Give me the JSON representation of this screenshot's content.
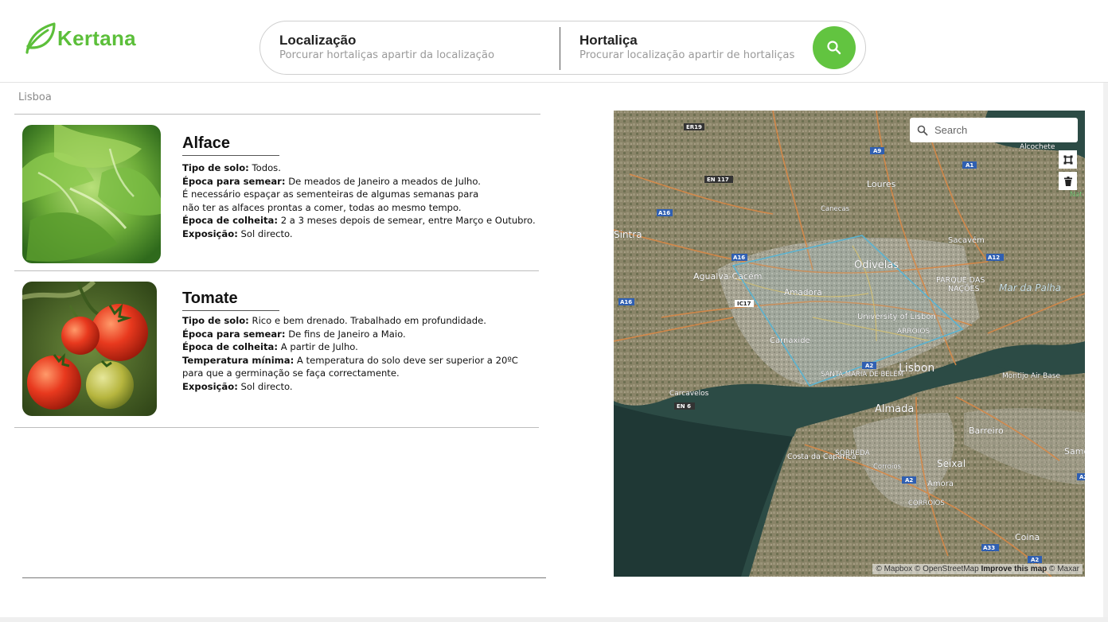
{
  "brand": {
    "name": "Kertana"
  },
  "search": {
    "location": {
      "title": "Localização",
      "placeholder": "Porcurar hortaliças apartir da localização"
    },
    "vegetable": {
      "title": "Hortaliça",
      "placeholder": "Procurar localização apartir de hortaliças"
    },
    "button_icon": "search-icon"
  },
  "breadcrumb": "Lisboa",
  "results": [
    {
      "name": "Alface",
      "lines": [
        {
          "label": "Tipo de solo:",
          "text": " Todos."
        },
        {
          "label": "Época para semear:",
          "text": " De meados de Janeiro a meados de Julho."
        },
        {
          "label": "",
          "text": "É necessário espaçar as sementeiras de algumas semanas para"
        },
        {
          "label": "",
          "text": "não ter as alfaces prontas a comer, todas ao mesmo tempo."
        },
        {
          "label": "Época de colheita:",
          "text": " 2 a 3 meses depois de semear, entre Março e Outubro."
        },
        {
          "label": "Exposição:",
          "text": " Sol directo."
        }
      ]
    },
    {
      "name": "Tomate",
      "lines": [
        {
          "label": "Tipo de solo:",
          "text": " Rico e bem drenado. Trabalhado em profundidade."
        },
        {
          "label": "Época para semear:",
          "text": " De fins de Janeiro a Maio."
        },
        {
          "label": "Época de colheita:",
          "text": " A partir de Julho."
        },
        {
          "label": "Temperatura mínima:",
          "text": " A temperatura do solo deve ser superior a 20ºC"
        },
        {
          "label": "",
          "text": "para que a germinação se faça correctamente."
        },
        {
          "label": "Exposição:",
          "text": " Sol directo."
        }
      ]
    }
  ],
  "map": {
    "search_placeholder": "Search",
    "tools": [
      "polygon-draw-icon",
      "trash-icon"
    ],
    "attribution": {
      "text": "© Mapbox © OpenStreetMap ",
      "improve": "Improve this map",
      "maxar": " © Maxar"
    },
    "places": [
      "Loures",
      "Canecas",
      "Sacavém",
      "Odivelas",
      "Sintra",
      "Agualva-Cacém",
      "Amadora",
      "PARQUE DAS",
      "NAÇÕES",
      "Mar da Palha",
      "University of Lisbon",
      "Carnaxide",
      "Lisbon",
      "SANTA MARIA DE BELÉM",
      "Carcavelos",
      "Almada",
      "Barreiro",
      "Montijo Air Base",
      "Costa da Caparica",
      "SOBREDA",
      "Corroios",
      "Seixal",
      "Amora",
      "CORROIOS",
      "Coina",
      "ARROIOS",
      "Alcochete",
      "Samora",
      "Nat"
    ],
    "roads": [
      "ER19",
      "A9",
      "A1",
      "EN 117",
      "A16",
      "A16",
      "A12",
      "IC17",
      "A16",
      "A2",
      "EN 6",
      "A2",
      "A2",
      "A33",
      "A2"
    ]
  }
}
